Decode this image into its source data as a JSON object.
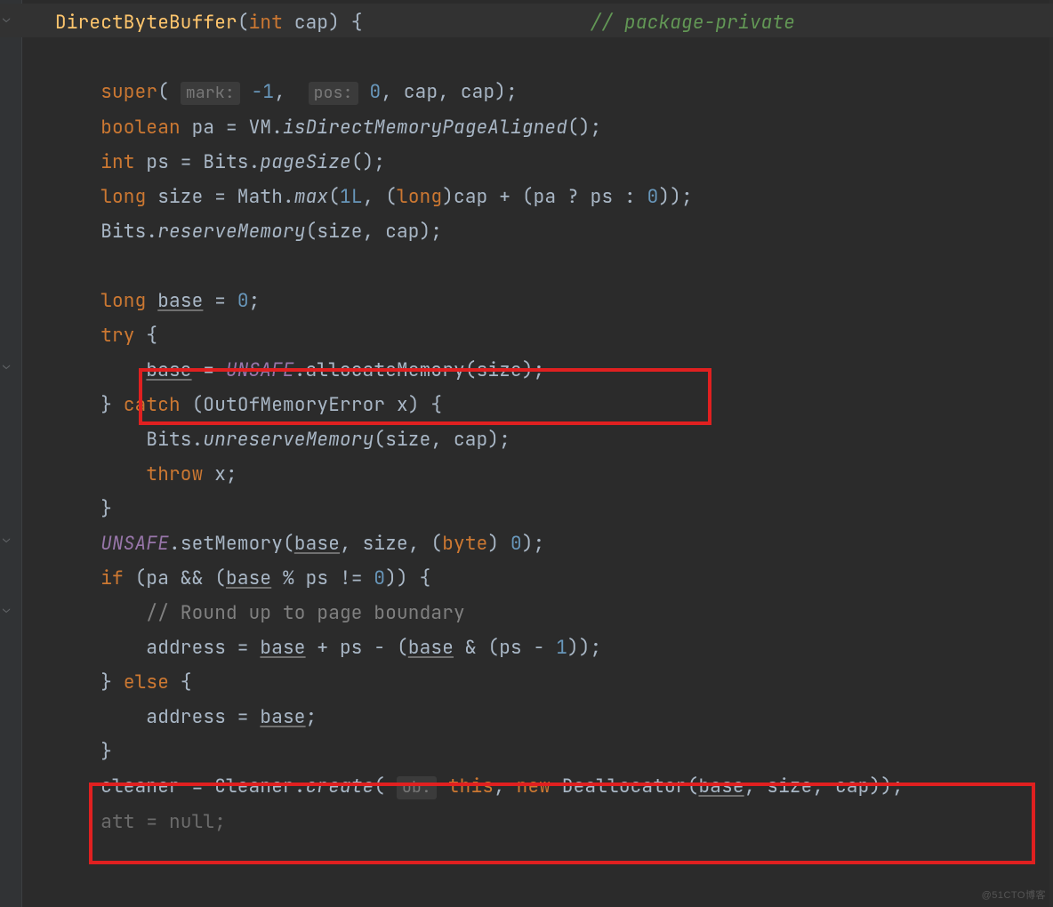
{
  "code": {
    "sig_name": "DirectByteBuffer",
    "sig_open": "(",
    "sig_ptype": "int",
    "sig_pname": " cap",
    "sig_close": ") {",
    "pkg_comment": "// package-private",
    "l_super_a": "super",
    "l_super_b": "(",
    "hint_mark": "mark:",
    "neg1": " -1",
    "comma1": ", ",
    "hint_pos": "pos:",
    "zero1": " 0",
    "rest_super": ", cap, cap);",
    "l_bool": "boolean",
    "l_pa_decl": " pa = VM.",
    "m_isdir": "isDirectMemoryPageAligned",
    "isdir_tail": "();",
    "l_int": "int",
    "l_ps_decl": " ps = Bits.",
    "m_pagesize": "pageSize",
    "pagesize_tail": "();",
    "l_long": "long",
    "l_size_decl": " size = Math.",
    "m_max": "max",
    "max_open": "(",
    "num_1L": "1L",
    "max_mid": ", (",
    "cast_long": "long",
    "max_mid2": ")cap + (pa ? ps : ",
    "zero2": "0",
    "max_tail": "));",
    "bits_res_a": "Bits.",
    "m_res": "reserveMemory",
    "bits_res_tail": "(size, cap);",
    "l_long2": "long",
    "base_decl_name": "base",
    "base_decl_mid": " = ",
    "zero3": "0",
    "base_decl_end": ";",
    "kw_try": "try",
    "try_open": " {",
    "base_assign_name": "base",
    "base_assign_eq": " = ",
    "unsafe1": "UNSAFE",
    "alloc_call": ".allocateMemory(size);",
    "kw_catch_close": "}",
    "kw_catch": " catch ",
    "catch_open": "(OutOfMemoryError x) {",
    "bits_unres_a": "Bits.",
    "m_unres": "unreserveMemory",
    "bits_unres_tail": "(size, cap);",
    "kw_throw": "throw",
    "throw_tail": " x;",
    "brace_close": "}",
    "unsafe2": "UNSAFE",
    "setmem_a": ".setMemory(",
    "base_ref1": "base",
    "setmem_mid": ", size, (",
    "cast_byte": "byte",
    "setmem_mid2": ") ",
    "zero4": "0",
    "setmem_end": ");",
    "kw_if": "if",
    "if_open": " (pa && (",
    "base_ref2": "base",
    "if_mid": " % ps != ",
    "zero5": "0",
    "if_tail": ")) {",
    "round_cmt": "// Round up to page boundary",
    "addr1": "address = ",
    "base_ref3": "base",
    "addr_mid": " + ps - (",
    "base_ref4": "base",
    "addr_mid2": " & (ps - ",
    "one": "1",
    "addr_end": "));",
    "else_close": "}",
    "kw_else": " else ",
    "else_open": "{",
    "addr2": "address = ",
    "base_ref5": "base",
    "addr2_end": ";",
    "brace_close2": "}",
    "cleaner_a": "cleaner = Cleaner.",
    "m_create": "create",
    "cleaner_open": "(",
    "hint_ob": "ob:",
    "kw_this": " this",
    "cleaner_mid": ", ",
    "kw_new": "new",
    "dealloc": " Deallocator(",
    "base_ref6": "base",
    "cleaner_end": ", size, cap));",
    "att_line": "att = ",
    "kw_null": "null",
    "att_end": ";"
  },
  "watermark": "@51CTO博客"
}
